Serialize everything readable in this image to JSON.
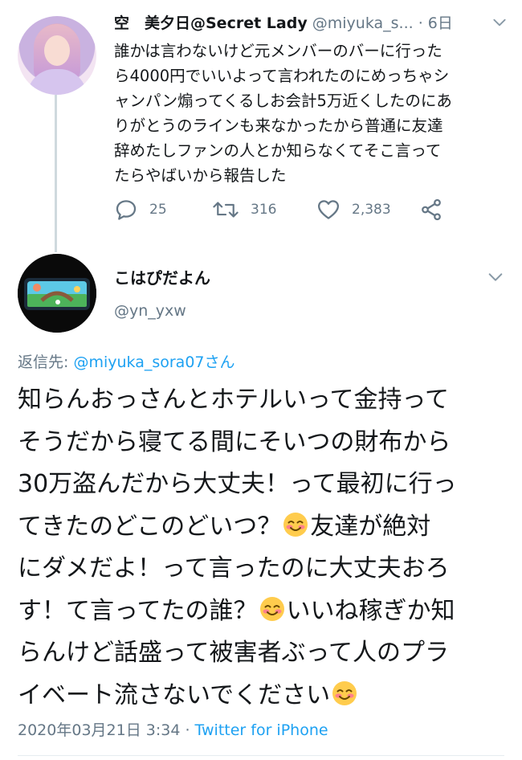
{
  "tweet": {
    "author_name": "空　美夕日@Secret Lady",
    "author_handle": "@miyuka_s...",
    "time": "· 6日",
    "text": "誰かは言わないけど元メンバーのバーに行った\nら4000円でいいよって言われたのにめっちゃシ\nャンパン煽ってくるしお会計5万近くしたのにあ\nりがとうのラインも来なかったから普通に友達\n辞めたしファンの人とか知らなくてそこ言って\nたらやばいから報告した",
    "actions": {
      "reply_count": "25",
      "retweet_count": "316",
      "like_count": "2,383"
    },
    "icons": [
      "reply-icon",
      "retweet-icon",
      "like-icon",
      "share-icon",
      "chevron-down-icon"
    ]
  },
  "reply": {
    "author_name": "こはぴだよん",
    "author_handle": "@yn_yxw",
    "reply_prefix": "返信先: ",
    "reply_to": "@miyuka_sora07さん",
    "lines": [
      {
        "text": "知らんおっさんとホテルいって金持って"
      },
      {
        "text": "そうだから寝てる間にそいつの財布から"
      },
      {
        "text": "30万盗んだから大丈夫！って最初に行っ"
      },
      {
        "pre": "てきたのどこのどいつ？",
        "emoji": "smiling-face-emoji",
        "post": "友達が絶対"
      },
      {
        "text": "にダメだよ！って言ったのに大丈夫おろ"
      },
      {
        "pre": "す！て言ってたの誰？",
        "emoji": "smiling-face-emoji",
        "post": "いいね稼ぎか知"
      },
      {
        "text": "らんけど話盛って被害者ぶって人のプラ"
      },
      {
        "pre": "イベート流さないでください",
        "emoji": "smiling-face-emoji",
        "post": ""
      }
    ],
    "timestamp": "2020年03月21日 3:34 · ",
    "source": "Twitter for iPhone"
  },
  "colors": {
    "text": "#14171a",
    "muted": "#657786",
    "link": "#1da1f2",
    "thread_line": "#cfd9de"
  }
}
